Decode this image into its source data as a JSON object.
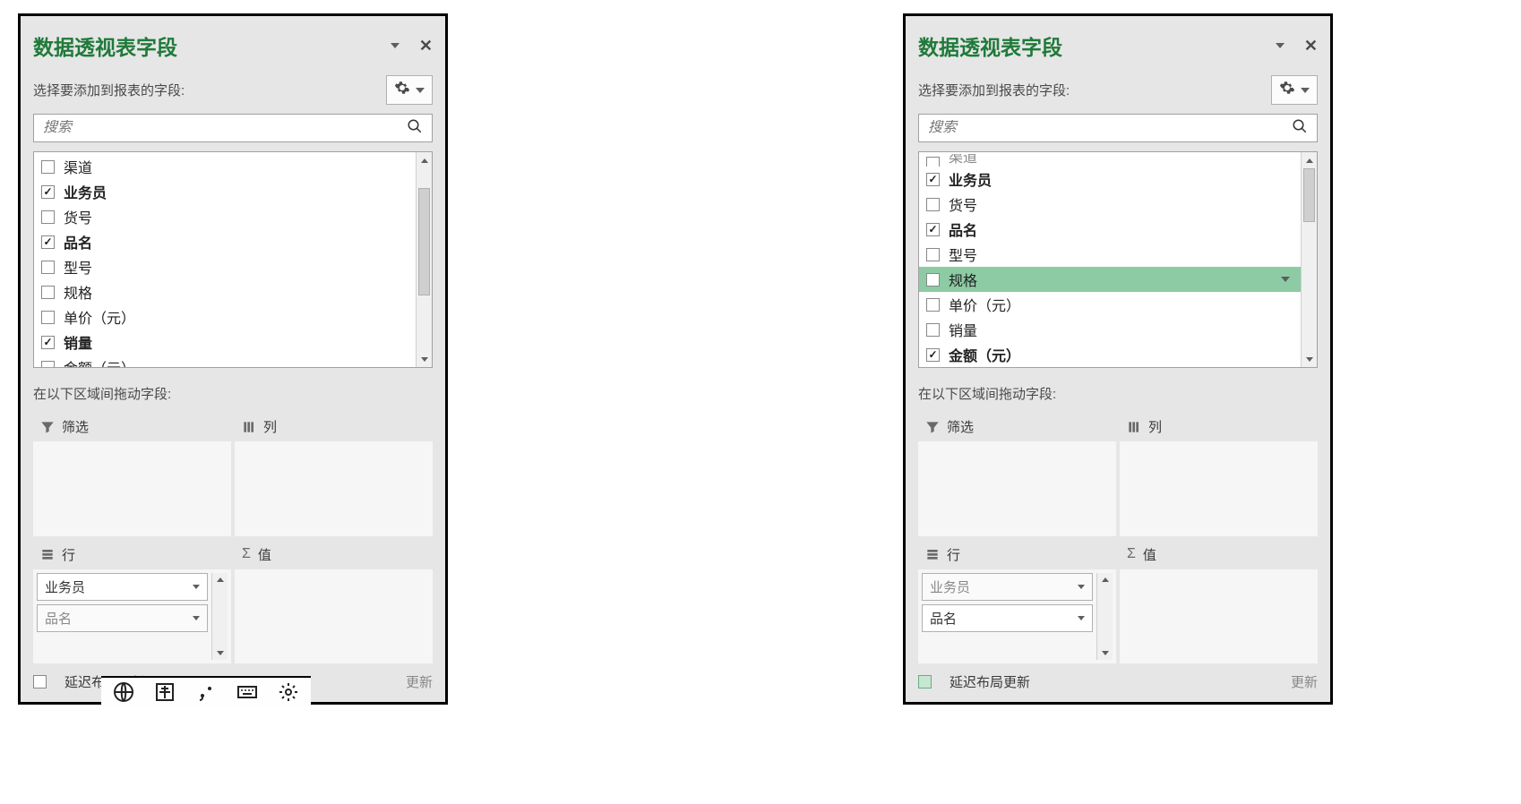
{
  "title": "数据透视表字段",
  "subheader": "选择要添加到报表的字段:",
  "search_placeholder": "搜索",
  "drag_hint": "在以下区域间拖动字段:",
  "defer_label": "延迟布局更新",
  "update_label": "更新",
  "zones": {
    "filters": "筛选",
    "columns": "列",
    "rows": "行",
    "values": "值"
  },
  "left": {
    "fields": [
      {
        "label": "渠道",
        "checked": false,
        "bold": false
      },
      {
        "label": "业务员",
        "checked": true,
        "bold": true
      },
      {
        "label": "货号",
        "checked": false,
        "bold": false
      },
      {
        "label": "品名",
        "checked": true,
        "bold": true
      },
      {
        "label": "型号",
        "checked": false,
        "bold": false
      },
      {
        "label": "规格",
        "checked": false,
        "bold": false
      },
      {
        "label": "单价（元）",
        "checked": false,
        "bold": false
      },
      {
        "label": "销量",
        "checked": true,
        "bold": true
      },
      {
        "label": "金额（元）",
        "checked": false,
        "bold": false
      }
    ],
    "rows_items": [
      "业务员",
      "品名"
    ],
    "defer_checked": false
  },
  "right": {
    "partial_top": "渠道",
    "fields": [
      {
        "label": "业务员",
        "checked": true,
        "bold": true,
        "highlighted": false
      },
      {
        "label": "货号",
        "checked": false,
        "bold": false,
        "highlighted": false
      },
      {
        "label": "品名",
        "checked": true,
        "bold": true,
        "highlighted": false
      },
      {
        "label": "型号",
        "checked": false,
        "bold": false,
        "highlighted": false
      },
      {
        "label": "规格",
        "checked": false,
        "bold": false,
        "highlighted": true
      },
      {
        "label": "单价（元）",
        "checked": false,
        "bold": false,
        "highlighted": false
      },
      {
        "label": "销量",
        "checked": false,
        "bold": false,
        "highlighted": false
      },
      {
        "label": "金额（元）",
        "checked": true,
        "bold": true,
        "highlighted": false
      }
    ],
    "rows_items": [
      "业务员",
      "品名"
    ],
    "defer_checked": false
  }
}
